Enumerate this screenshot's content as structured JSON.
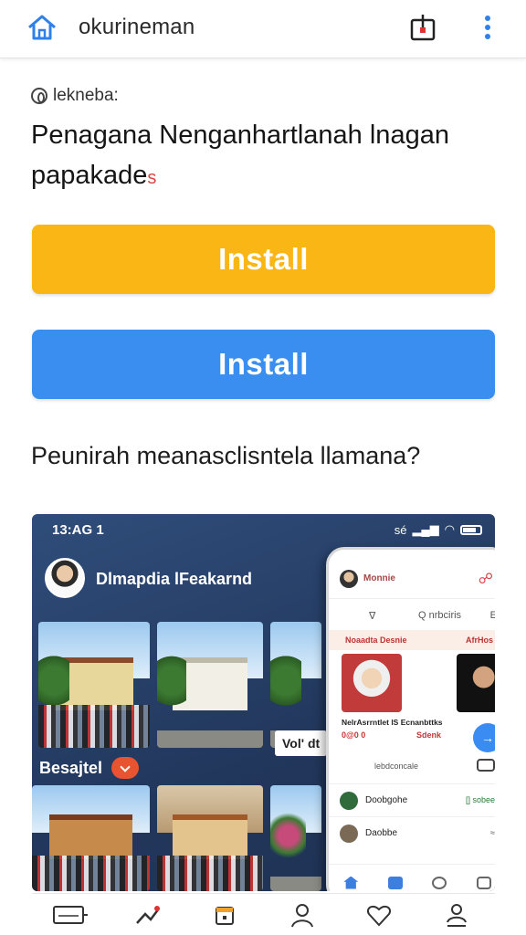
{
  "topbar": {
    "site_name": "okurineman",
    "icons": [
      "home-icon",
      "share-icon",
      "more-vertical-icon"
    ],
    "accent": "#2f80e8"
  },
  "section": {
    "label": "lekneba:"
  },
  "headline": {
    "text": "Penagana Nenganhartlanah lnagan papakade",
    "suffix": "s"
  },
  "buttons": {
    "install_primary": "Install",
    "install_secondary": "Install",
    "primary_color": "#f9b614",
    "secondary_color": "#3a8ef0"
  },
  "question": "Peunirah meanasclisntela llamana?",
  "promo": {
    "status_time": "13:AG 1",
    "status_right": "sé",
    "app_title": "Dlmapdia lFeakarnd",
    "vol_label": "Vol' dt",
    "category_label": "Besajtel",
    "phone": {
      "title": "Monnie",
      "search_left": "∇",
      "search_mid": "Q nrbciris",
      "search_right": "E",
      "tab_left": "Noaadta Desnie",
      "tab_right": "AfrHos",
      "caption": "NelrAsrrntlet lS Ecnanbttks",
      "red_left": "0@0 0",
      "red_right": "Sdenk",
      "row0": "lebdconcale",
      "rows": [
        {
          "name": "Doobgohe",
          "right": "[] sobee"
        },
        {
          "name": "Daobbe",
          "right": "≈"
        }
      ]
    }
  },
  "bottom_nav": [
    "keyboard-icon",
    "trending-icon",
    "calendar-icon",
    "profile-icon",
    "heart-icon",
    "account-icon"
  ]
}
